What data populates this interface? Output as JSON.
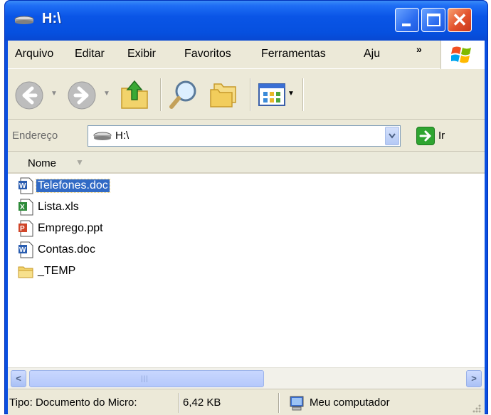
{
  "window": {
    "title": "H:\\"
  },
  "menu": {
    "items": [
      "Arquivo",
      "Editar",
      "Exibir",
      "Favoritos",
      "Ferramentas",
      "Aju"
    ],
    "overflow": "»"
  },
  "toolbar": {
    "back_icon": "back-arrow-icon",
    "forward_icon": "forward-arrow-icon",
    "up_icon": "folder-up-icon",
    "search_icon": "search-icon",
    "folders_icon": "folders-icon",
    "views_icon": "views-icon"
  },
  "address": {
    "label": "Endereço",
    "value": "H:\\",
    "go_label": "Ir"
  },
  "list": {
    "column_name": "Nome",
    "files": [
      {
        "name": "Telefones.doc",
        "icon": "word-doc-icon",
        "selected": true
      },
      {
        "name": "Lista.xls",
        "icon": "excel-xls-icon",
        "selected": false
      },
      {
        "name": "Emprego.ppt",
        "icon": "powerpoint-ppt-icon",
        "selected": false
      },
      {
        "name": "Contas.doc",
        "icon": "word-doc-icon",
        "selected": false
      },
      {
        "name": "_TEMP",
        "icon": "folder-icon",
        "selected": false
      }
    ]
  },
  "status": {
    "type": "Tipo: Documento do Micro:",
    "size": "6,42 KB",
    "location": "Meu computador"
  },
  "colors": {
    "titlebar": "#0a55e6",
    "selection": "#316ac5",
    "chrome": "#ece9d8"
  }
}
